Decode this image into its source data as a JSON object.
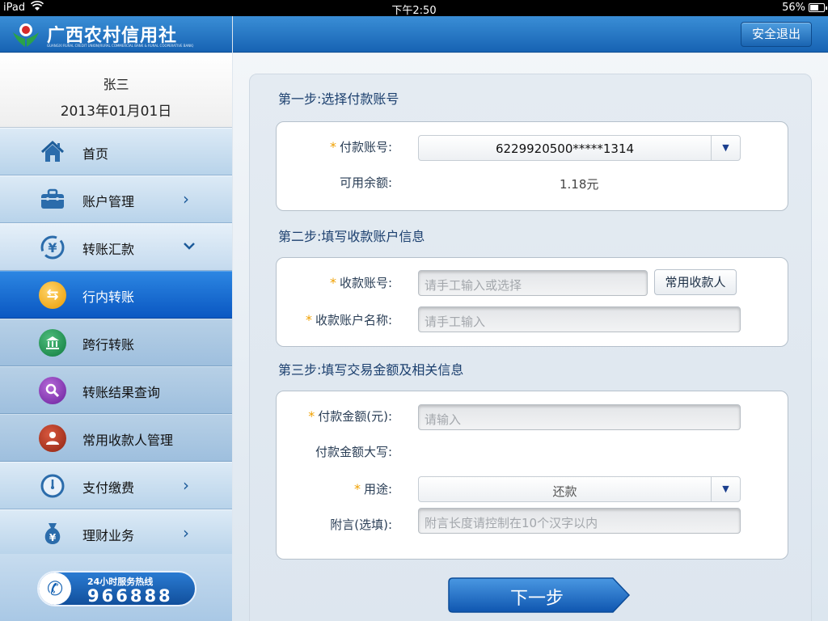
{
  "status_bar": {
    "carrier": "iPad",
    "time": "下午2:50",
    "battery": "56%"
  },
  "header": {
    "bank_name": "广西农村信用社",
    "bank_subtitle": "GUANGXI RURAL CREDIT UNION(RURAL COMMERCIAL BANK & RURAL COOPERATIVE BANK)",
    "logout_label": "安全退出",
    "brand_color": "#1a6bbf"
  },
  "sidebar": {
    "user_name": "张三",
    "date": "2013年01月01日",
    "items": [
      {
        "label": "首页",
        "icon": "home-icon"
      },
      {
        "label": "账户管理",
        "icon": "briefcase-icon"
      },
      {
        "label": "转账汇款",
        "icon": "yen-transfer-icon"
      },
      {
        "label": "行内转账",
        "icon": "exchange-arrows-icon"
      },
      {
        "label": "跨行转账",
        "icon": "bank-building-icon"
      },
      {
        "label": "转账结果查询",
        "icon": "magnifier-icon"
      },
      {
        "label": "常用收款人管理",
        "icon": "person-icon"
      },
      {
        "label": "支付缴费",
        "icon": "clock-icon"
      },
      {
        "label": "理财业务",
        "icon": "money-bag-icon"
      }
    ],
    "hotline_title": "24小时服务热线",
    "hotline_number": "966888"
  },
  "main": {
    "step1": {
      "title": "第一步:选择付款账号",
      "account_label": "付款账号:",
      "account_value": "6229920500*****1314",
      "balance_label": "可用余额:",
      "balance_value": "1.18元"
    },
    "step2": {
      "title": "第二步:填写收款账户信息",
      "payee_account_label": "收款账号:",
      "payee_account_placeholder": "请手工输入或选择",
      "frequent_payee_button": "常用收款人",
      "payee_name_label": "收款账户名称:",
      "payee_name_placeholder": "请手工输入"
    },
    "step3": {
      "title": "第三步:填写交易金额及相关信息",
      "amount_label": "付款金额(元):",
      "amount_placeholder": "请输入",
      "amount_upper_label": "付款金额大写:",
      "purpose_label": "用途:",
      "purpose_value": "还款",
      "note_label": "附言(选填):",
      "note_placeholder": "附言长度请控制在10个汉字以内"
    },
    "next_button": "下一步"
  }
}
